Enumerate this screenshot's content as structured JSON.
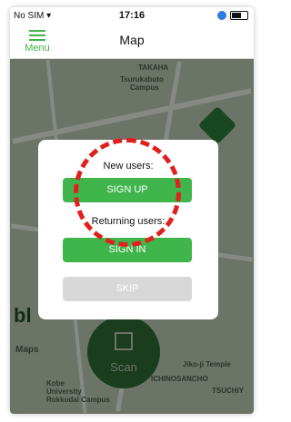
{
  "statusbar": {
    "carrier": "No SIM",
    "wifi_icon": "wifi-icon",
    "time": "17:16",
    "location_icon": "location-icon",
    "battery_icon": "battery-icon"
  },
  "navbar": {
    "menu_label": "Menu",
    "title": "Map"
  },
  "map": {
    "labels": {
      "takaha": "TAKAHA",
      "tsurukabuto": "Tsurukabuto",
      "campus": "Campus",
      "maps": "Maps",
      "jiko": "Jiko-ji Temple",
      "ichinosancho": "ICHINOSANCHO",
      "tsuchiy": "TSUCHIY",
      "kobe": "Kobe",
      "university": "University",
      "rokkodai": "Rokkodai Campus",
      "big_letters": "bl"
    },
    "scan_label": "Scan"
  },
  "dialog": {
    "new_users_label": "New users:",
    "signup_label": "SIGN UP",
    "returning_users_label": "Returning users:",
    "signin_label": "SIGN IN",
    "skip_label": "SKIP"
  },
  "colors": {
    "accent": "#3fb54b",
    "highlight": "#e0201c",
    "skip": "#d8d8d8"
  }
}
